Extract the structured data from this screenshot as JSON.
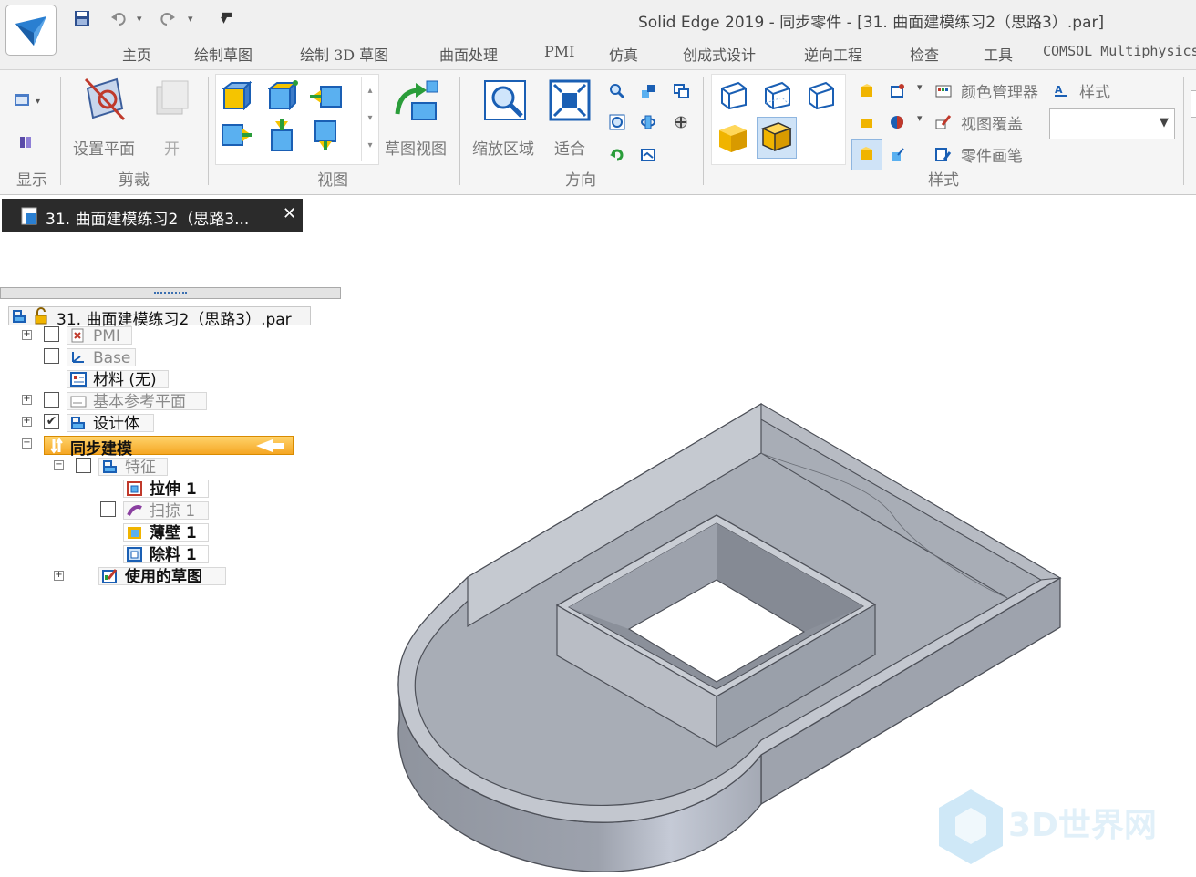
{
  "titlebar": {
    "title": "Solid Edge 2019 - 同步零件 - [31. 曲面建模练习2（思路3）.par]",
    "quick_access": [
      "save-icon",
      "undo-icon",
      "redo-icon",
      "customize-icon"
    ]
  },
  "menu_tabs": [
    "主页",
    "绘制草图",
    "绘制 3D 草图",
    "曲面处理",
    "PMI",
    "仿真",
    "创成式设计",
    "逆向工程",
    "检查",
    "工具",
    "COMSOL Multiphysics"
  ],
  "ribbon": {
    "groups": {
      "display": "显示",
      "clip": "剪裁",
      "view": "视图",
      "orient": "方向",
      "style": "样式"
    },
    "buttons": {
      "set_plane": "设置平面",
      "open": "开",
      "sketch_view": "草图视图",
      "zoom_area": "缩放区域",
      "fit": "适合",
      "color_manager": "颜色管理器",
      "view_override": "视图覆盖",
      "part_painter": "零件画笔",
      "styles": "样式"
    },
    "style_dropdown_value": ""
  },
  "document_tab": {
    "label": "31. 曲面建模练习2（思路3...",
    "close": "✕"
  },
  "tree": {
    "root": "31. 曲面建模练习2（思路3）.par",
    "items": {
      "pmi": "PMI",
      "base": "Base",
      "material": "材料 (无)",
      "ref_planes": "基本参考平面",
      "design_body": "设计体",
      "sync": "同步建模",
      "features": "特征",
      "extrude": "拉伸 1",
      "sweep": "扫掠 1",
      "shell": "薄壁 1",
      "cutout": "除料 1",
      "used_sketches": "使用的草图"
    }
  },
  "watermark": "3D世界网",
  "colors": {
    "accent_orange": "#f5a623",
    "model_gray": "#a3a8b2",
    "tab_dark": "#2b2b2b"
  }
}
